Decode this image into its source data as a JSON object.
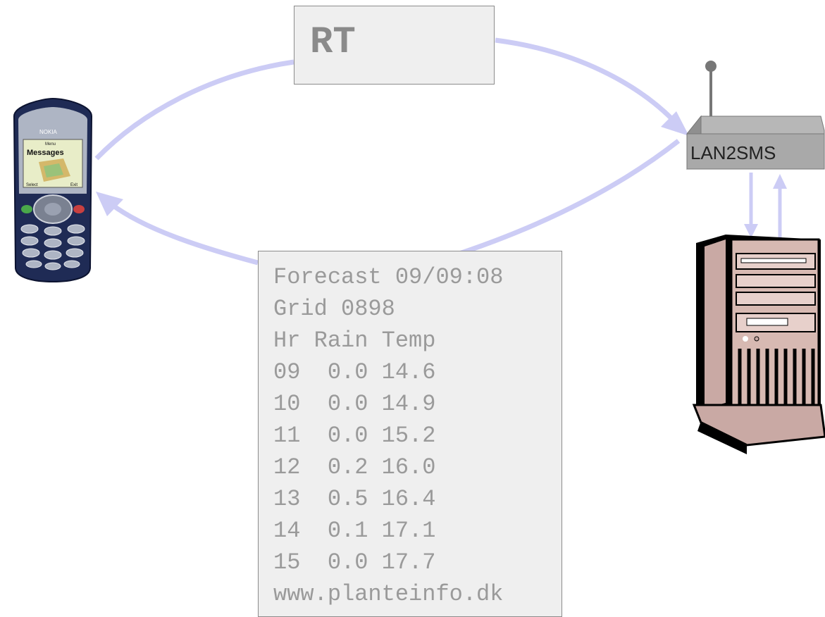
{
  "nodes": {
    "rt": {
      "label": "RT"
    },
    "lan2sms": {
      "label": "LAN2SMS"
    },
    "phone": {
      "brand": "NOKIA",
      "screen_title": "Messages",
      "screen_header": "Menu",
      "left_soft_key": "Select",
      "right_soft_key": "Exit"
    },
    "server": {}
  },
  "sms_message": {
    "lines": [
      "Forecast 09/09:08",
      "Grid 0898",
      "Hr Rain Temp",
      "09  0.0 14.6",
      "10  0.0 14.9",
      "11  0.0 15.2",
      "12  0.2 16.0",
      "13  0.5 16.4",
      "14  0.1 17.1",
      "15  0.0 17.7",
      "www.planteinfo.dk"
    ]
  },
  "colors": {
    "arrow": "#ccccf5",
    "box_fill": "#efefef",
    "box_border": "#8c8c8c",
    "text_gray": "#9a9a9a",
    "phone_body": "#1f2b55",
    "server_beige": "#d7b9b2"
  }
}
